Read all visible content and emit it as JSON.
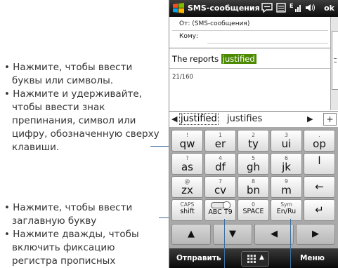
{
  "annotations": {
    "block1": [
      "Нажмите, чтобы ввести буквы или символы.",
      "Нажмите и удерживайте, чтобы ввести знак препинания, символ или цифру, обозначенную сверху клавиши."
    ],
    "block2": [
      "Нажмите, чтобы ввести заглавную букву",
      "Нажмите дважды, чтобы включить фиксацию регистра прописных"
    ]
  },
  "titlebar": {
    "title": "SMS-сообщения",
    "ok": "ok",
    "icons": [
      "windows-logo-icon",
      "messaging-icon",
      "inbox-icon",
      "signal-icon",
      "volume-icon"
    ]
  },
  "message": {
    "from": "От: (SMS-сообщения)",
    "to": "Кому:",
    "text": "The reports ",
    "highlight": "justified",
    "counter": "21/160"
  },
  "suggestions": {
    "word1": "justified",
    "word2": "justifies",
    "plus": "+"
  },
  "keyboard": {
    "row1": [
      {
        "small": "!",
        "main": "qw"
      },
      {
        "small": "1",
        "main": "er"
      },
      {
        "small": "2",
        "main": "ty"
      },
      {
        "small": "3",
        "main": "ui"
      },
      {
        "small": ".",
        "main": "op"
      }
    ],
    "row2": [
      {
        "small": "?",
        "main": "as"
      },
      {
        "small": "4",
        "main": "df"
      },
      {
        "small": "5",
        "main": "gh"
      },
      {
        "small": "6",
        "main": "jk"
      },
      {
        "small": "",
        "main": "l"
      }
    ],
    "row3": [
      {
        "small": "@",
        "main": "zx"
      },
      {
        "small": "7",
        "main": "cv"
      },
      {
        "small": "8",
        "main": "bn"
      },
      {
        "small": "9",
        "main": "m"
      },
      {
        "small": "",
        "main": "←"
      }
    ],
    "row4": [
      {
        "small": "CAPS",
        "main": "shift"
      },
      {
        "small": "",
        "main": "ABC T9"
      },
      {
        "small": "0",
        "main": "SPACE"
      },
      {
        "small": "Sym",
        "main": "En/Ru"
      },
      {
        "small": "",
        "main": "↵"
      }
    ]
  },
  "softbar": {
    "left": "Отправить",
    "right": "Меню"
  }
}
